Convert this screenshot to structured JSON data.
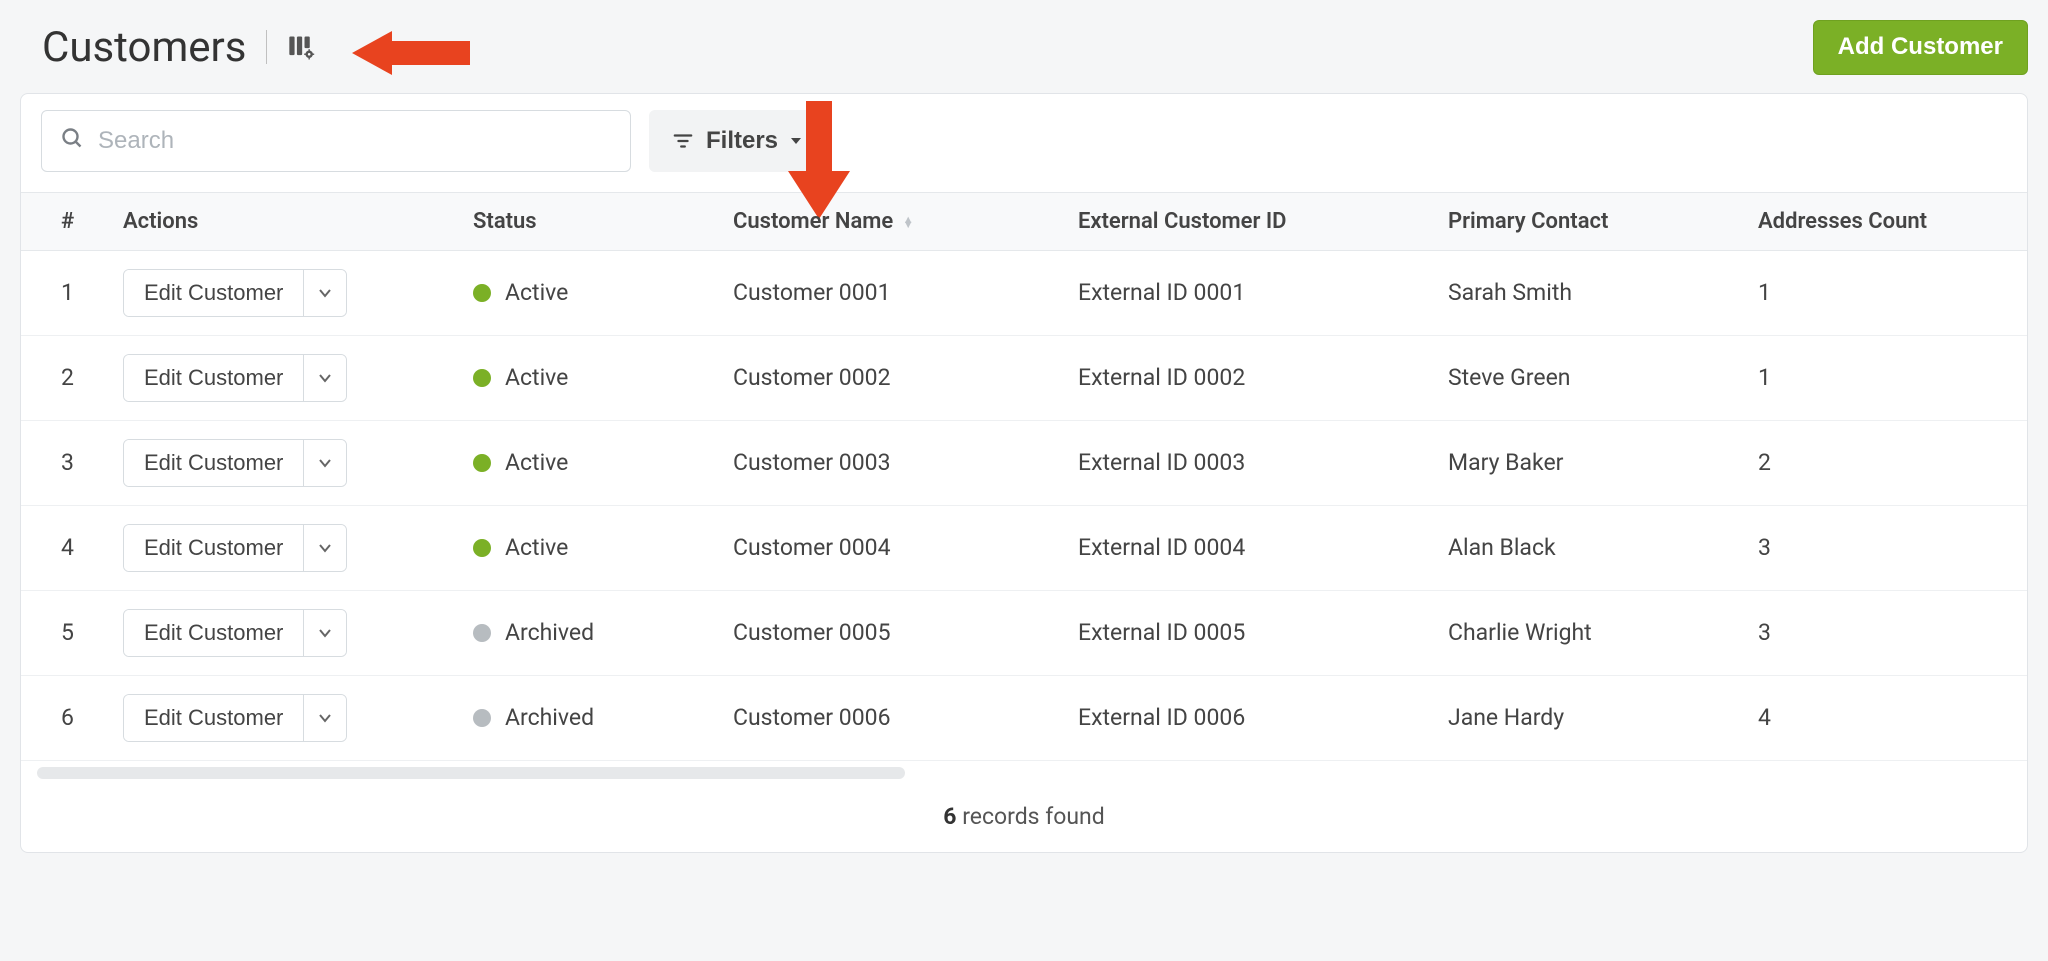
{
  "header": {
    "title": "Customers",
    "add_button_label": "Add Customer"
  },
  "toolbar": {
    "search_placeholder": "Search",
    "filters_label": "Filters"
  },
  "table": {
    "headers": {
      "num": "#",
      "actions": "Actions",
      "status": "Status",
      "name": "Customer Name",
      "external_id": "External Customer ID",
      "primary_contact": "Primary Contact",
      "addresses": "Addresses Count"
    },
    "edit_label": "Edit Customer",
    "status_labels": {
      "active": "Active",
      "archived": "Archived"
    },
    "rows": [
      {
        "num": "1",
        "status": "active",
        "name": "Customer 0001",
        "external_id": "External ID 0001",
        "contact": "Sarah Smith",
        "addresses": "1"
      },
      {
        "num": "2",
        "status": "active",
        "name": "Customer 0002",
        "external_id": "External ID 0002",
        "contact": "Steve Green",
        "addresses": "1"
      },
      {
        "num": "3",
        "status": "active",
        "name": "Customer 0003",
        "external_id": "External ID 0003",
        "contact": "Mary Baker",
        "addresses": "2"
      },
      {
        "num": "4",
        "status": "active",
        "name": "Customer 0004",
        "external_id": "External ID 0004",
        "contact": "Alan Black",
        "addresses": "3"
      },
      {
        "num": "5",
        "status": "archived",
        "name": "Customer 0005",
        "external_id": "External ID 0005",
        "contact": "Charlie Wright",
        "addresses": "3"
      },
      {
        "num": "6",
        "status": "archived",
        "name": "Customer 0006",
        "external_id": "External ID 0006",
        "contact": "Jane Hardy",
        "addresses": "4"
      }
    ]
  },
  "footer": {
    "count": "6",
    "suffix": " records found"
  }
}
